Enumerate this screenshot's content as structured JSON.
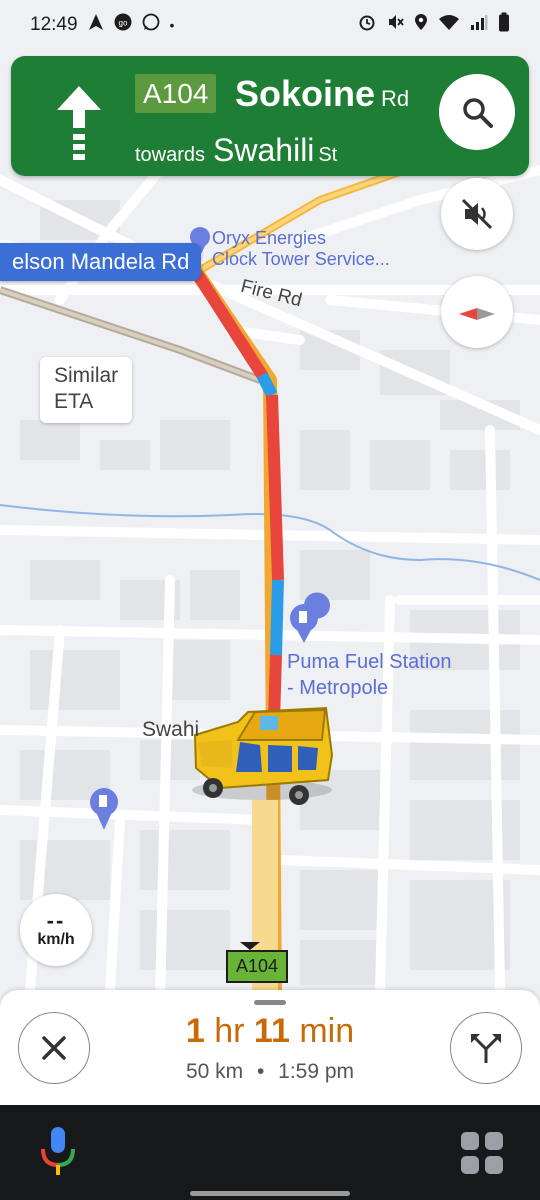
{
  "status_bar": {
    "time": "12:49",
    "indicator_dot": "•"
  },
  "banner": {
    "route_shield": "A104",
    "street_name": "Sokoine",
    "street_suffix": "Rd",
    "towards_label": "towards",
    "towards_street": "Swahili",
    "towards_suffix": "St",
    "background_color": "#1e7e35"
  },
  "map": {
    "road_label": "elson Mandela Rd",
    "eta_chip_line1": "Similar",
    "eta_chip_line2": "ETA",
    "fire_rd": "Fire Rd",
    "poi_oryx_line1": "Oryx Energies",
    "poi_oryx_line2": "Clock Tower Service...",
    "poi_puma_line1": "Puma Fuel Station",
    "poi_puma_line2": "- Metropole",
    "swahili_label": "Swahi",
    "route_shield_small": "A104",
    "speed_value": "--",
    "speed_unit": "km/h"
  },
  "trip": {
    "eta_hours": "1",
    "eta_hr_unit": "hr",
    "eta_minutes": "11",
    "eta_min_unit": "min",
    "distance": "50 km",
    "separator": "•",
    "arrival": "1:59 pm"
  },
  "icons": {
    "search": "search-icon",
    "mute": "volume-mute-icon",
    "compass": "compass-icon",
    "close": "close-icon",
    "alternate_routes": "alternate-routes-icon",
    "mic": "mic-icon",
    "apps": "apps-grid-icon"
  }
}
